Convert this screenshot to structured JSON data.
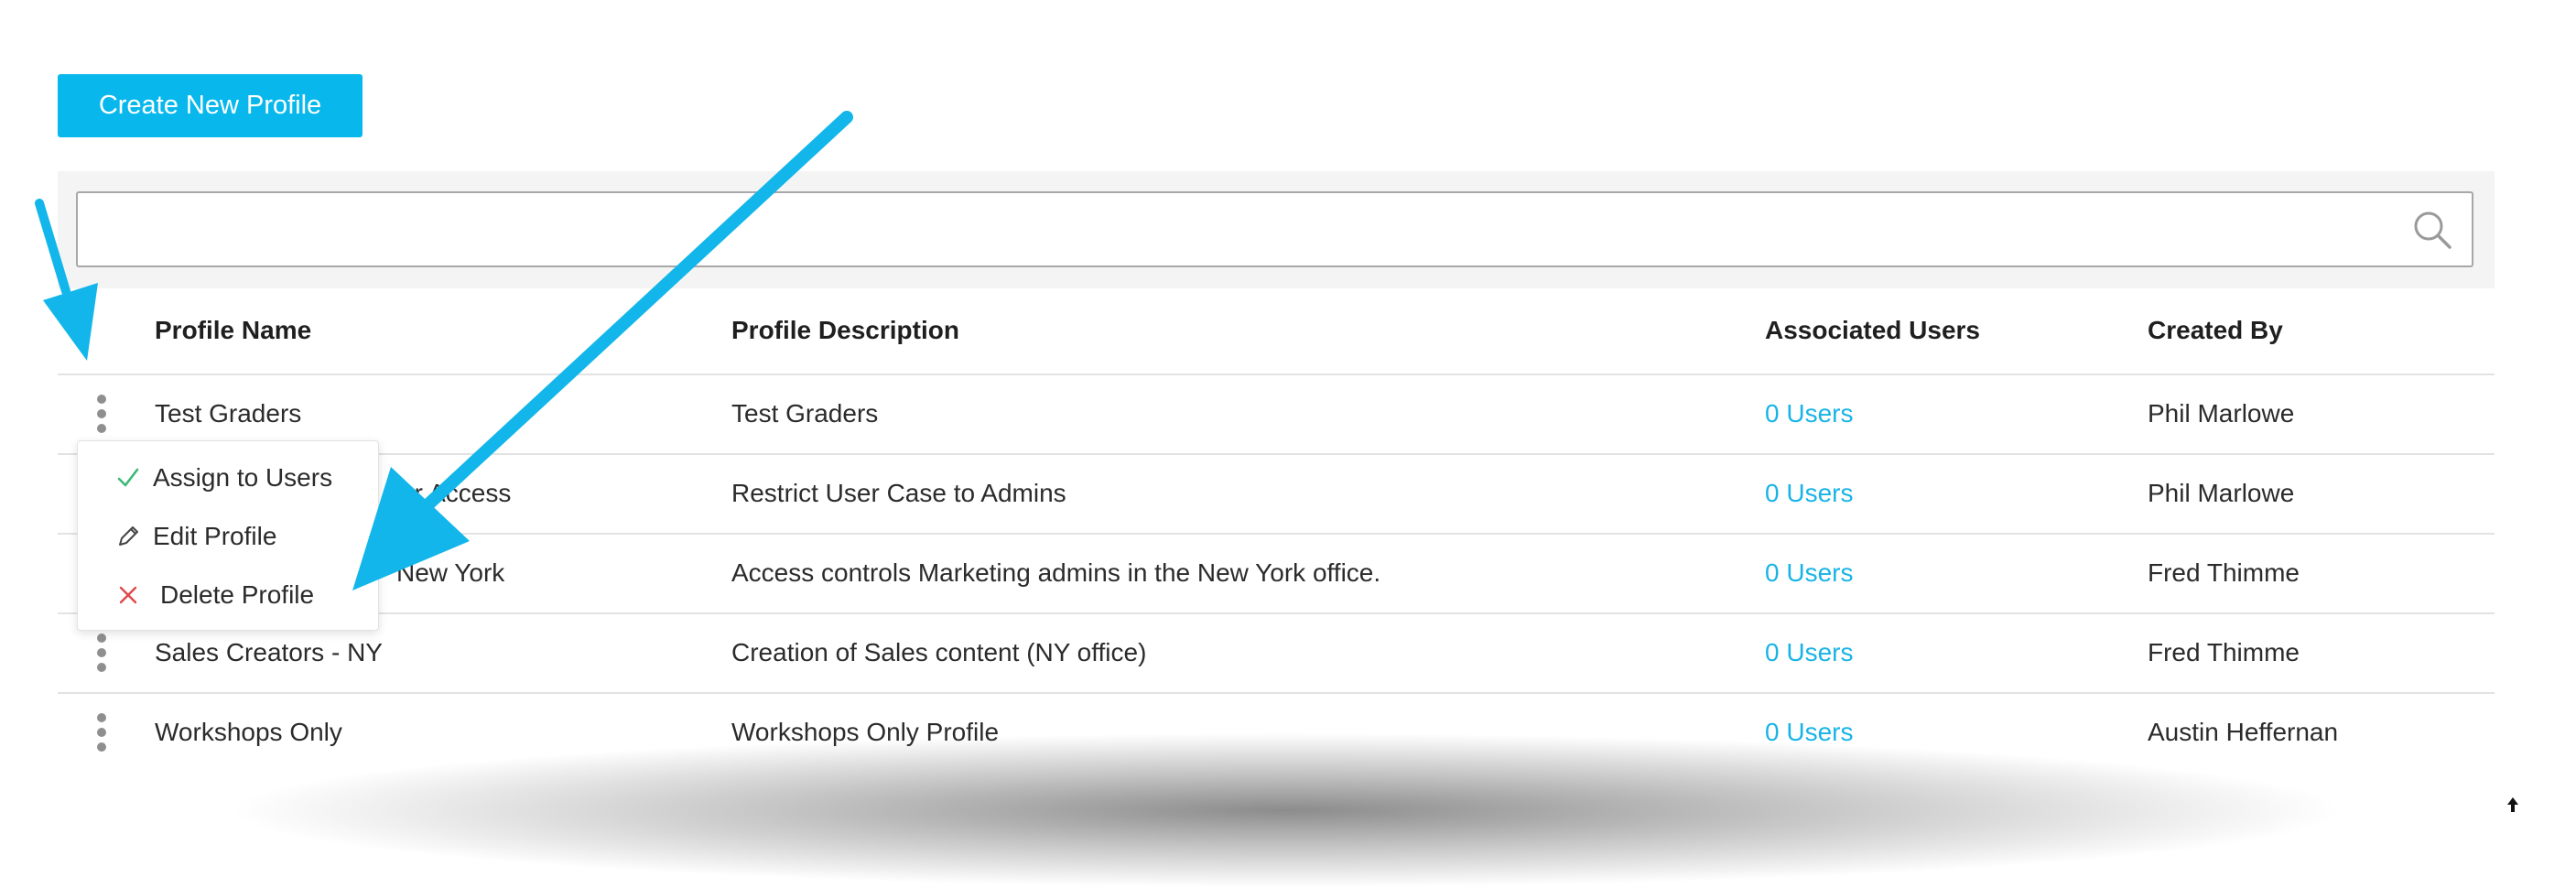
{
  "toolbar": {
    "create_label": "Create New Profile"
  },
  "search": {
    "value": "",
    "placeholder": ""
  },
  "table": {
    "headers": {
      "name": "Profile Name",
      "description": "Profile Description",
      "users": "Associated Users",
      "created_by": "Created By"
    },
    "rows": [
      {
        "name": "Test Graders",
        "description": "Test Graders",
        "users": "0 Users",
        "created_by": "Phil Marlowe"
      },
      {
        "name": "ser Access",
        "description": "Restrict User Case to Admins",
        "users": "0 Users",
        "created_by": "Phil Marlowe"
      },
      {
        "name": "New York",
        "description": "Access controls Marketing admins in the New York office.",
        "users": "0 Users",
        "created_by": "Fred Thimme"
      },
      {
        "name": "Sales Creators - NY",
        "description": "Creation of Sales content (NY office)",
        "users": "0 Users",
        "created_by": "Fred Thimme"
      },
      {
        "name": "Workshops Only",
        "description": "Workshops Only Profile",
        "users": "0 Users",
        "created_by": "Austin Heffernan"
      }
    ]
  },
  "menu": {
    "items": [
      {
        "label": "Assign to Users",
        "icon": "check-icon"
      },
      {
        "label": "Edit Profile",
        "icon": "pencil-icon"
      },
      {
        "label": "Delete Profile",
        "icon": "x-icon"
      }
    ]
  },
  "colors": {
    "accent": "#08b8ec",
    "link": "#19b4e6",
    "check": "#3cb878",
    "delete": "#e0484a",
    "annotation_arrow": "#12b6ea"
  }
}
